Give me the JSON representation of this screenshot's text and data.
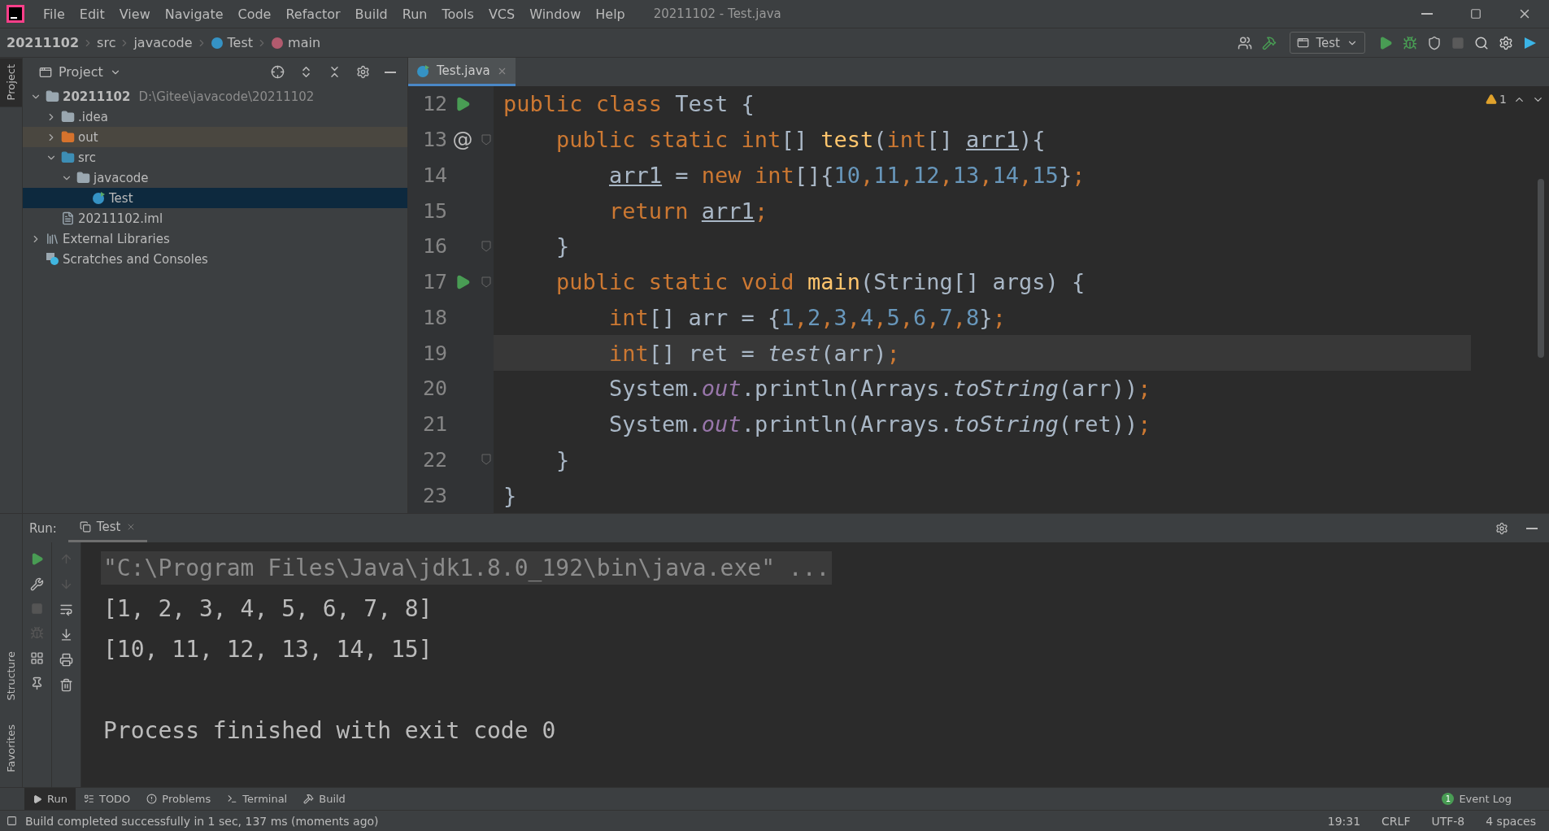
{
  "app_logo": {
    "kind": "ij"
  },
  "menu": [
    "File",
    "Edit",
    "View",
    "Navigate",
    "Code",
    "Refactor",
    "Build",
    "Run",
    "Tools",
    "VCS",
    "Window",
    "Help"
  ],
  "window": {
    "title": "20211102 - Test.java"
  },
  "breadcrumbs": [
    {
      "label": "20211102",
      "kind": "project"
    },
    {
      "label": "src",
      "kind": "folder"
    },
    {
      "label": "javacode",
      "kind": "folder"
    },
    {
      "label": "Test",
      "kind": "class"
    },
    {
      "label": "main",
      "kind": "method"
    }
  ],
  "run_config": {
    "label": "Test"
  },
  "side_tabs_top": [
    {
      "label": "Project",
      "selected": true
    }
  ],
  "side_tabs_bottom": [
    {
      "label": "Structure",
      "selected": false
    },
    {
      "label": "Favorites",
      "selected": false
    }
  ],
  "project_panel": {
    "title": "Project",
    "tree": [
      {
        "label": "20211102",
        "kind": "module",
        "path": "D:\\Gitee\\javacode\\20211102",
        "expanded": true,
        "selected": false,
        "children": [
          {
            "label": ".idea",
            "kind": "folder",
            "expanded": false,
            "selected": false
          },
          {
            "label": "out",
            "kind": "excluded",
            "expanded": false,
            "selected": false
          },
          {
            "label": "src",
            "kind": "source",
            "expanded": true,
            "selected": false,
            "children": [
              {
                "label": "javacode",
                "kind": "package",
                "expanded": true,
                "selected": false,
                "children": [
                  {
                    "label": "Test",
                    "kind": "class",
                    "selected": true
                  }
                ]
              }
            ]
          },
          {
            "label": "20211102.iml",
            "kind": "file",
            "selected": false
          }
        ]
      },
      {
        "label": "External Libraries",
        "kind": "libraries",
        "expanded": false,
        "selected": false
      },
      {
        "label": "Scratches and Consoles",
        "kind": "scratches",
        "selected": false
      }
    ]
  },
  "editor_tabs": [
    {
      "label": "Test.java",
      "selected": true
    }
  ],
  "inspections": {
    "warnings": "1"
  },
  "code_lines": [
    {
      "number": "12",
      "gutter": {
        "kind": "run"
      },
      "fold": false,
      "current": false,
      "tokens": [
        {
          "text": "public class ",
          "kind": "keyword"
        },
        {
          "text": "Test {",
          "kind": "plain"
        }
      ]
    },
    {
      "number": "13",
      "gutter": {
        "kind": "override",
        "text": "@"
      },
      "fold": true,
      "current": false,
      "tokens": [
        {
          "text": "    public static ",
          "kind": "keyword"
        },
        {
          "text": "int",
          "kind": "keyword"
        },
        {
          "text": "[] ",
          "kind": "plain"
        },
        {
          "text": "test",
          "kind": "method"
        },
        {
          "text": "(",
          "kind": "plain"
        },
        {
          "text": "int",
          "kind": "keyword"
        },
        {
          "text": "[] ",
          "kind": "plain"
        },
        {
          "text": "arr1",
          "kind": "param"
        },
        {
          "text": "){",
          "kind": "plain"
        }
      ]
    },
    {
      "number": "14",
      "fold": false,
      "current": false,
      "tokens": [
        {
          "text": "        arr1",
          "kind": "param"
        },
        {
          "text": " = ",
          "kind": "plain"
        },
        {
          "text": "new ",
          "kind": "keyword"
        },
        {
          "text": "int",
          "kind": "keyword"
        },
        {
          "text": "[]{",
          "kind": "plain"
        },
        {
          "text": "10",
          "kind": "number"
        },
        {
          "text": ",",
          "kind": "keyword"
        },
        {
          "text": "11",
          "kind": "number"
        },
        {
          "text": ",",
          "kind": "keyword"
        },
        {
          "text": "12",
          "kind": "number"
        },
        {
          "text": ",",
          "kind": "keyword"
        },
        {
          "text": "13",
          "kind": "number"
        },
        {
          "text": ",",
          "kind": "keyword"
        },
        {
          "text": "14",
          "kind": "number"
        },
        {
          "text": ",",
          "kind": "keyword"
        },
        {
          "text": "15",
          "kind": "number"
        },
        {
          "text": "}",
          "kind": "plain"
        },
        {
          "text": ";",
          "kind": "keyword"
        }
      ]
    },
    {
      "number": "15",
      "fold": false,
      "current": false,
      "tokens": [
        {
          "text": "        return ",
          "kind": "keyword"
        },
        {
          "text": "arr1",
          "kind": "param"
        },
        {
          "text": ";",
          "kind": "keyword"
        }
      ]
    },
    {
      "number": "16",
      "fold": true,
      "current": false,
      "tokens": [
        {
          "text": "    }",
          "kind": "plain"
        }
      ]
    },
    {
      "number": "17",
      "gutter": {
        "kind": "run"
      },
      "fold": true,
      "current": false,
      "tokens": [
        {
          "text": "    public static void ",
          "kind": "keyword"
        },
        {
          "text": "main",
          "kind": "method"
        },
        {
          "text": "(String[] args) {",
          "kind": "plain"
        }
      ]
    },
    {
      "number": "18",
      "fold": false,
      "current": false,
      "tokens": [
        {
          "text": "        int",
          "kind": "keyword"
        },
        {
          "text": "[] arr = {",
          "kind": "plain"
        },
        {
          "text": "1",
          "kind": "number"
        },
        {
          "text": ",",
          "kind": "keyword"
        },
        {
          "text": "2",
          "kind": "number"
        },
        {
          "text": ",",
          "kind": "keyword"
        },
        {
          "text": "3",
          "kind": "number"
        },
        {
          "text": ",",
          "kind": "keyword"
        },
        {
          "text": "4",
          "kind": "number"
        },
        {
          "text": ",",
          "kind": "keyword"
        },
        {
          "text": "5",
          "kind": "number"
        },
        {
          "text": ",",
          "kind": "keyword"
        },
        {
          "text": "6",
          "kind": "number"
        },
        {
          "text": ",",
          "kind": "keyword"
        },
        {
          "text": "7",
          "kind": "number"
        },
        {
          "text": ",",
          "kind": "keyword"
        },
        {
          "text": "8",
          "kind": "number"
        },
        {
          "text": "}",
          "kind": "plain"
        },
        {
          "text": ";",
          "kind": "keyword"
        }
      ]
    },
    {
      "number": "19",
      "fold": false,
      "current": true,
      "tokens": [
        {
          "text": "        int",
          "kind": "keyword"
        },
        {
          "text": "[] ret = ",
          "kind": "plain"
        },
        {
          "text": "test",
          "kind": "static"
        },
        {
          "text": "(arr)",
          "kind": "plain"
        },
        {
          "text": ";",
          "kind": "keyword"
        }
      ]
    },
    {
      "number": "20",
      "fold": false,
      "current": false,
      "tokens": [
        {
          "text": "        System.",
          "kind": "plain"
        },
        {
          "text": "out",
          "kind": "field"
        },
        {
          "text": ".println(Arrays.",
          "kind": "plain"
        },
        {
          "text": "toString",
          "kind": "static"
        },
        {
          "text": "(arr))",
          "kind": "plain"
        },
        {
          "text": ";",
          "kind": "keyword"
        }
      ]
    },
    {
      "number": "21",
      "fold": false,
      "current": false,
      "tokens": [
        {
          "text": "        System.",
          "kind": "plain"
        },
        {
          "text": "out",
          "kind": "field"
        },
        {
          "text": ".println(Arrays.",
          "kind": "plain"
        },
        {
          "text": "toString",
          "kind": "static"
        },
        {
          "text": "(ret))",
          "kind": "plain"
        },
        {
          "text": ";",
          "kind": "keyword"
        }
      ]
    },
    {
      "number": "22",
      "fold": true,
      "current": false,
      "tokens": [
        {
          "text": "    }",
          "kind": "plain"
        }
      ]
    },
    {
      "number": "23",
      "fold": false,
      "current": false,
      "tokens": [
        {
          "text": "}",
          "kind": "plain"
        }
      ]
    }
  ],
  "run_panel": {
    "label": "Run:",
    "tabs": [
      {
        "label": "Test",
        "selected": true
      }
    ],
    "console": [
      {
        "text": "\"C:\\Program Files\\Java\\jdk1.8.0_192\\bin\\java.exe\" ...",
        "kind": "command"
      },
      {
        "text": "[1, 2, 3, 4, 5, 6, 7, 8]",
        "kind": "output"
      },
      {
        "text": "[10, 11, 12, 13, 14, 15]",
        "kind": "output"
      },
      {
        "text": "Process finished with exit code 0",
        "kind": "exit"
      }
    ]
  },
  "tool_windows": [
    {
      "label": "Run",
      "kind": "run",
      "selected": true
    },
    {
      "label": "TODO",
      "kind": "todo",
      "selected": false
    },
    {
      "label": "Problems",
      "kind": "problems",
      "selected": false
    },
    {
      "label": "Terminal",
      "kind": "terminal",
      "selected": false
    },
    {
      "label": "Build",
      "kind": "build",
      "selected": false
    }
  ],
  "event_log": {
    "label": "Event Log",
    "count": "1"
  },
  "status_bar": {
    "message": "Build completed successfully in 1 sec, 137 ms (moments ago)",
    "items": [
      "19:31",
      "CRLF",
      "UTF-8",
      "4 spaces"
    ]
  }
}
